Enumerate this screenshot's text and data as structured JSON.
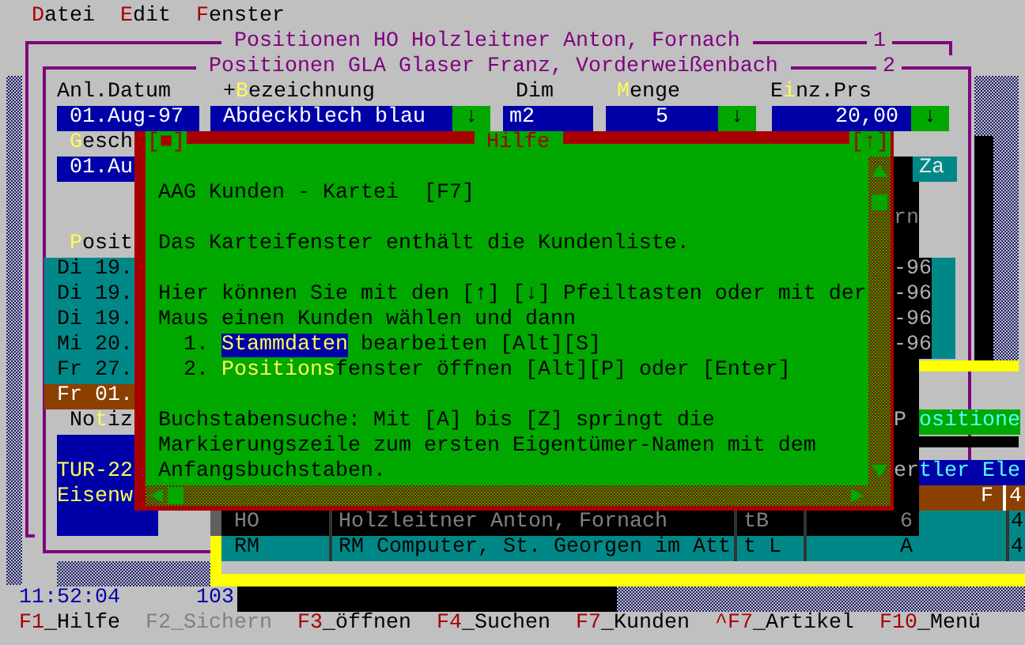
{
  "menu_bar": [
    "**D**atei",
    "**E**dit",
    "**F**enster"
  ],
  "windows": [
    {
      "title": "Positionen HO Holzleitner Anton, Fornach",
      "number": "1"
    },
    {
      "title": "Positionen GLA Glaser Franz, Vorderweißenbach",
      "number": "2"
    }
  ],
  "form": {
    "columns": [
      {
        "header": "Anl.Datum",
        "value": "01.Aug-97"
      },
      {
        "header": "+**B**ezeichnung",
        "value": "Abdeckblech blau",
        "button": "↓"
      },
      {
        "header": "Dim",
        "value": "m2"
      },
      {
        "header": "**M**enge",
        "value": "5",
        "button": "↓"
      },
      {
        "header": "E**i**nz.Prs",
        "value": "20,00",
        "button": "↓"
      }
    ],
    "second_label": "**G**esch",
    "second_value": "01.Au",
    "second_right": "Za",
    "third_right": "rn"
  },
  "positions": {
    "heading": "**P**osit",
    "rows": [
      {
        "start": "Di 19.",
        "end": "-96",
        "selected": false
      },
      {
        "start": "Di 19.",
        "end": "-96",
        "selected": false
      },
      {
        "start": "Di 19.",
        "end": "-96",
        "selected": false
      },
      {
        "start": "Mi 20.",
        "end": "-96",
        "selected": false
      },
      {
        "start": "Fr 27.",
        "selected": false
      },
      {
        "start": "Fr 01.",
        "selected": true
      }
    ]
  },
  "notes": {
    "label": "No**t**iz",
    "lines": [
      "TUR-22",
      "Eisenw"
    ]
  },
  "right_side": {
    "tab": "ositione",
    "tab_shadow": "P",
    "dealer_shadow": "er",
    "dealer": "tler Ele",
    "flag": "F",
    "flag_count": "4"
  },
  "help": {
    "title": "Hilfe",
    "close": "[■]",
    "zoom": "[↑]",
    "paragraphs": [
      [
        {
          "kind": "text",
          "text": "AAG Kunden - Kartei  [F7]"
        }
      ],
      [
        {
          "kind": "text",
          "text": "Das Karteifenster enthält die Kundenliste."
        }
      ],
      [
        {
          "kind": "text",
          "text": "Hier können Sie mit den [↑] [↓] Pfeiltasten oder mit der"
        },
        {
          "kind": "text",
          "text": "Maus einen Kunden wählen und dann"
        },
        {
          "kind": "link",
          "number": "1.",
          "link": "Stammdaten",
          "rest": " bearbeiten [Alt][S]",
          "selected": true
        },
        {
          "kind": "link",
          "number": "2.",
          "link": "Positions",
          "rest": "fenster öffnen [Alt][P] oder [Enter]",
          "selected": false
        }
      ],
      [
        {
          "kind": "text",
          "text": "Buchstabensuche: Mit [A] bis [Z] springt die"
        },
        {
          "kind": "text",
          "text": "Markierungszeile zum ersten Eigentümer-Namen mit dem"
        },
        {
          "kind": "text",
          "text": "Anfangsbuchstaben."
        }
      ]
    ]
  },
  "customer_list": [
    {
      "cells": [
        "HO",
        "Holzleitner Anton, Fornach",
        "tB",
        "6",
        "4"
      ],
      "in_shadow": true
    },
    {
      "cells": [
        "RM",
        "RM Computer, St. Georgen im Att",
        "t L",
        "A",
        "4"
      ],
      "in_shadow": false
    }
  ],
  "status_bar": {
    "time": "11:52:04",
    "count": "103"
  },
  "function_keys": [
    {
      "label": "**F1**_Hilfe",
      "disabled": false
    },
    {
      "label": "**F2**_Sichern",
      "disabled": true
    },
    {
      "label": "**F3**_öffnen",
      "disabled": false
    },
    {
      "label": "**F4**_Suchen",
      "disabled": false
    },
    {
      "label": "**F7**_Kunden",
      "disabled": false
    },
    {
      "label": "**^F7**_Artikel",
      "disabled": false
    },
    {
      "label": "**F10**_Menü",
      "disabled": false
    }
  ]
}
